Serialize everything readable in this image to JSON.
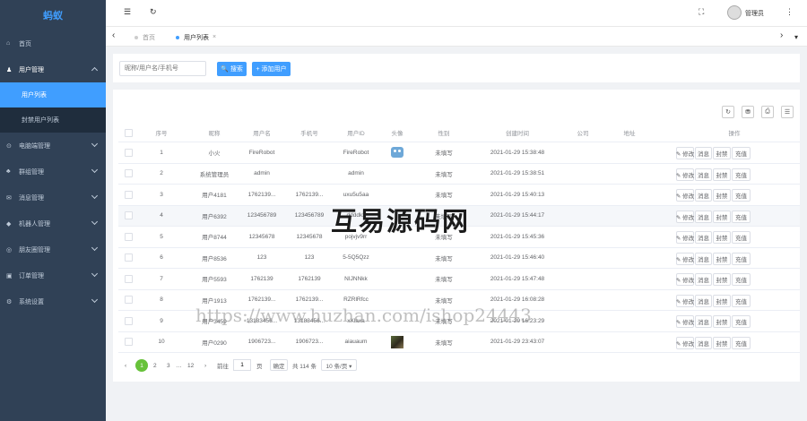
{
  "app": {
    "logo": "蚂蚁"
  },
  "sidebar": {
    "items": [
      {
        "label": "首页",
        "icon": "home-icon",
        "glyph": "⌂"
      },
      {
        "label": "用户管理",
        "icon": "user-icon",
        "glyph": "♟",
        "open": true,
        "children": [
          {
            "label": "用户列表",
            "active": true
          },
          {
            "label": "封禁用户列表"
          }
        ]
      },
      {
        "label": "电脑端管理",
        "icon": "monitor-icon",
        "glyph": "⊙"
      },
      {
        "label": "群组管理",
        "icon": "group-icon",
        "glyph": "♣"
      },
      {
        "label": "消息管理",
        "icon": "message-icon",
        "glyph": "✉"
      },
      {
        "label": "机器人管理",
        "icon": "robot-icon",
        "glyph": "◆"
      },
      {
        "label": "朋友圈管理",
        "icon": "moments-icon",
        "glyph": "◎"
      },
      {
        "label": "订单管理",
        "icon": "order-icon",
        "glyph": "▣"
      },
      {
        "label": "系统设置",
        "icon": "settings-icon",
        "glyph": "⚙"
      }
    ]
  },
  "header": {
    "menu_toggle": "☰",
    "refresh": "↻",
    "fullscreen": "⛶",
    "more": "⋮",
    "user_name": "管理员"
  },
  "tabs": {
    "items": [
      {
        "label": "首页"
      },
      {
        "label": "用户列表",
        "active": true
      }
    ],
    "close_glyph": "×",
    "left_arrow": "‹",
    "right_arrow": "›"
  },
  "search": {
    "placeholder": "昵称/用户名/手机号",
    "search_label": "🔍 搜索",
    "add_label": "+ 添加用户"
  },
  "toolbar": {
    "refresh": "↻",
    "export": "⛃",
    "print": "⎙",
    "columns": "☰"
  },
  "table": {
    "columns": [
      "序号",
      "昵称",
      "用户名",
      "手机号",
      "用户ID",
      "头像",
      "性别",
      "创建时间",
      "公司",
      "地址",
      "操作"
    ],
    "actions": [
      "✎ 修改",
      "消息",
      "封禁",
      "充值"
    ],
    "rows": [
      {
        "no": "1",
        "nickname": "小火",
        "username": "FireRobot",
        "phone": "",
        "uid": "FireRobot",
        "avatar": "robot",
        "gender": "未填写",
        "created": "2021-01-29 15:38:48"
      },
      {
        "no": "2",
        "nickname": "系统管理员",
        "username": "admin",
        "phone": "",
        "uid": "admin",
        "avatar": "",
        "gender": "未填写",
        "created": "2021-01-29 15:38:51"
      },
      {
        "no": "3",
        "nickname": "用户4181",
        "username": "1762139...",
        "phone": "1762139...",
        "uid": "uxu5u5aa",
        "avatar": "",
        "gender": "未填写",
        "created": "2021-01-29 15:40:13"
      },
      {
        "no": "4",
        "nickname": "用户6392",
        "username": "123456789",
        "phone": "123456789",
        "uid": "ddddkx",
        "avatar": "",
        "gender": "未填写",
        "created": "2021-01-29 15:44:17",
        "highlight": true
      },
      {
        "no": "5",
        "nickname": "用户8744",
        "username": "12345678",
        "phone": "12345678",
        "uid": "pojvjv9rr",
        "avatar": "",
        "gender": "未填写",
        "created": "2021-01-29 15:45:36"
      },
      {
        "no": "6",
        "nickname": "用户8536",
        "username": "123",
        "phone": "123",
        "uid": "5-5Q5Qzz",
        "avatar": "",
        "gender": "未填写",
        "created": "2021-01-29 15:46:40"
      },
      {
        "no": "7",
        "nickname": "用户5593",
        "username": "1762139",
        "phone": "1762139",
        "uid": "NIJNNkk",
        "avatar": "",
        "gender": "未填写",
        "created": "2021-01-29 15:47:48"
      },
      {
        "no": "8",
        "nickname": "用户1913",
        "username": "1762139...",
        "phone": "1762139...",
        "uid": "RZRlRfcc",
        "avatar": "",
        "gender": "未填写",
        "created": "2021-01-29 16:08:28"
      },
      {
        "no": "9",
        "nickname": "用户3459",
        "username": "13183456...",
        "phone": "13183456...",
        "uid": "xXlaxa",
        "avatar": "",
        "gender": "未填写",
        "created": "2021-01-29 16:23:29"
      },
      {
        "no": "10",
        "nickname": "用户0290",
        "username": "1906723...",
        "phone": "1906723...",
        "uid": "aiauaum",
        "avatar": "photo",
        "gender": "未填写",
        "created": "2021-01-29 23:43:07"
      }
    ]
  },
  "pagination": {
    "prev": "‹",
    "pages": [
      "1",
      "2",
      "3",
      "…",
      "12"
    ],
    "next": "›",
    "goto_label": "前往",
    "page_value": "1",
    "page_unit": "页",
    "confirm": "确定",
    "total": "共 114 条",
    "page_size": "10 条/页 ▾"
  },
  "watermarks": {
    "brand": "互易源码网",
    "url": "https://www.huzhan.com/ishop24443"
  },
  "colors": {
    "sidebar_bg": "#304156",
    "accent": "#409eff",
    "pager_active": "#67c23a"
  }
}
